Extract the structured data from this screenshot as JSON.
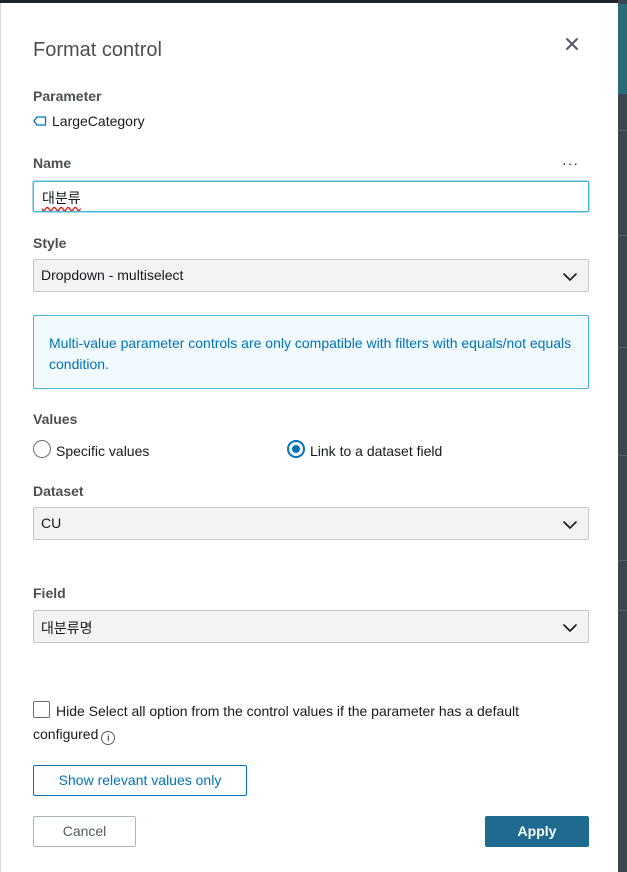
{
  "modal": {
    "title": "Format control",
    "close_icon": "close-icon"
  },
  "parameter": {
    "label": "Parameter",
    "value": "LargeCategory",
    "icon": "parameter-tag-icon"
  },
  "name": {
    "label": "Name",
    "value": "대분류",
    "more_label": "···"
  },
  "style": {
    "label": "Style",
    "selected": "Dropdown - multiselect"
  },
  "info": {
    "message": "Multi-value parameter controls are only compatible with filters with equals/not equals condition."
  },
  "values": {
    "label": "Values",
    "options": [
      {
        "label": "Specific values",
        "checked": false
      },
      {
        "label": "Link to a dataset field",
        "checked": true
      }
    ]
  },
  "dataset": {
    "label": "Dataset",
    "selected": "CU"
  },
  "field": {
    "label": "Field",
    "selected": "대분류명"
  },
  "hide_select_all": {
    "label": "Hide Select all option from the control values if the parameter has a default configured",
    "checked": false
  },
  "buttons": {
    "relevant": "Show relevant values only",
    "cancel": "Cancel",
    "apply": "Apply"
  },
  "colors": {
    "accent": "#0073bb",
    "apply_bg": "#1e6b8f",
    "info_bg": "#f1faff"
  }
}
